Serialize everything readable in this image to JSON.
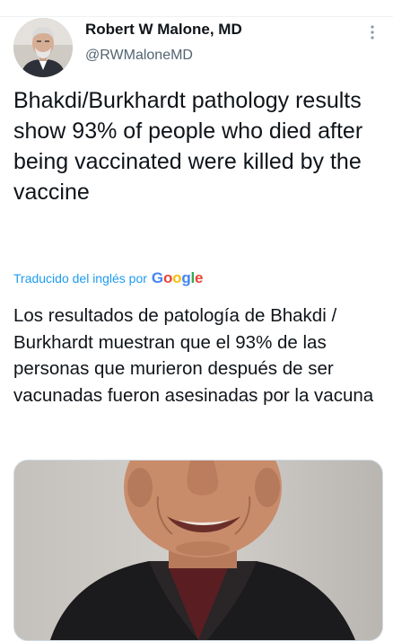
{
  "author": {
    "display_name": "Robert W Malone, MD",
    "handle": "@RWMaloneMD"
  },
  "tweet": {
    "text": "Bhakdi/Burkhardt pathology results show 93% of people who died after being vaccinated were killed by the vaccine"
  },
  "translation": {
    "label": "Traducido del inglés por",
    "provider": "Google",
    "text": "Los resultados de patología de Bhakdi / Burkhardt muestran que el 93% de las personas que murieron después de ser vacunadas fueron asesinadas por la vacuna"
  },
  "icons": {
    "more": "more-options-icon",
    "avatar": "profile-photo",
    "media": "photo-of-smiling-man"
  },
  "colors": {
    "link_blue": "#1d9bf0",
    "secondary_text": "#536471",
    "primary_text": "#0f1419",
    "google_blue": "#4285F4",
    "google_red": "#EA4335",
    "google_yellow": "#FBBC05",
    "google_green": "#34A853"
  }
}
